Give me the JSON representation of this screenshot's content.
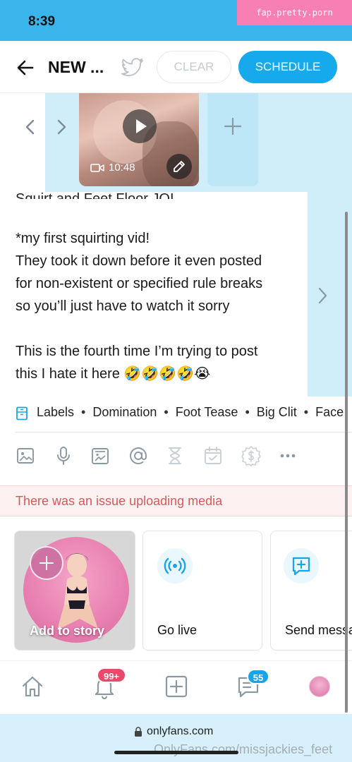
{
  "status_bar": {
    "time": "8:39",
    "tag": "fap.pretty.porn"
  },
  "header": {
    "title": "NEW ...",
    "clear_label": "CLEAR",
    "schedule_label": "SCHEDULE"
  },
  "media": {
    "duration": "10:48"
  },
  "post": {
    "cut_line": "Squirt and Feet Floor JOI",
    "body": "*my first squirting vid!\nThey took it down before it even posted\nfor non-existent or specified rule breaks\nso you’ll just have to watch it sorry\n\nThis is the fourth time I’m trying to post\nthis I hate it here 🤣🤣🤣🤣😭"
  },
  "labels": {
    "title": "Labels",
    "items": [
      "Domination",
      "Foot Tease",
      "Big Clit",
      "Face"
    ]
  },
  "toolbar": {
    "icons": [
      "image-icon",
      "microphone-icon",
      "vault-icon",
      "mention-icon",
      "hourglass-icon",
      "calendar-icon",
      "price-icon",
      "more-icon"
    ]
  },
  "error": {
    "message": "There was an issue uploading media"
  },
  "cards": {
    "story": "Add to story",
    "live": "Go live",
    "message": "Send message"
  },
  "bottom_nav": {
    "notifications_badge": "99+",
    "messages_badge": "55"
  },
  "browser": {
    "url": "onlyfans.com",
    "watermark": "OnlyFans.com/missjackies_feet"
  },
  "colors": {
    "accent": "#16aaec",
    "status_bar": "#3ab4ea",
    "error": "#d25b5b",
    "badge_notif": "#ea4a6a",
    "badge_msg": "#1aa3e8"
  }
}
